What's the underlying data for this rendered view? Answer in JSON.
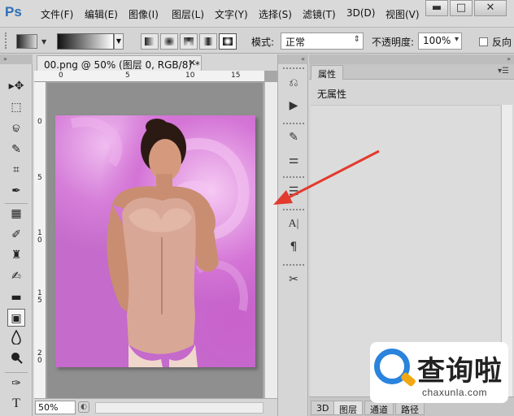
{
  "app": {
    "logo": "Ps",
    "menu": [
      "文件(F)",
      "编辑(E)",
      "图像(I)",
      "图层(L)",
      "文字(Y)",
      "选择(S)",
      "滤镜(T)",
      "3D(D)",
      "视图(V)"
    ],
    "window_buttons": {
      "minimize": "▬",
      "maximize": "□",
      "close": "✕"
    }
  },
  "options_bar": {
    "mode_label": "模式:",
    "mode_value": "正常",
    "opacity_label": "不透明度:",
    "opacity_value": "100%",
    "reverse_label": "反向"
  },
  "toolbox": {
    "tools": [
      {
        "icon": "move-icon",
        "glyph": "▸✥"
      },
      {
        "icon": "marquee-icon",
        "glyph": "⬚"
      },
      {
        "icon": "lasso-icon",
        "glyph": "ଢ"
      },
      {
        "icon": "quick-select-icon",
        "glyph": "✎"
      },
      {
        "icon": "crop-icon",
        "glyph": "⌗"
      },
      {
        "icon": "eyedropper-icon",
        "glyph": "✒"
      },
      {
        "icon": "healing-brush-icon",
        "glyph": "▦"
      },
      {
        "icon": "brush-icon",
        "glyph": "✐"
      },
      {
        "icon": "clone-stamp-icon",
        "glyph": "♜"
      },
      {
        "icon": "history-brush-icon",
        "glyph": "✍"
      },
      {
        "icon": "eraser-icon",
        "glyph": "▬"
      },
      {
        "icon": "gradient-icon",
        "glyph": "▣"
      },
      {
        "icon": "blur-icon",
        "glyph": "💧"
      },
      {
        "icon": "dodge-icon",
        "glyph": "●"
      },
      {
        "icon": "pen-icon",
        "glyph": "✑"
      },
      {
        "icon": "type-icon",
        "glyph": "T"
      }
    ]
  },
  "document": {
    "tab_title": "00.png @ 50% (图层 0, RGB/8) *",
    "tab_close": "✕",
    "ruler_h": [
      "0",
      "5",
      "10",
      "15"
    ],
    "ruler_v": [
      "0",
      "5",
      "1\n0",
      "1\n5",
      "2\n0"
    ],
    "zoom": "50%"
  },
  "properties_panel": {
    "tab": "属性",
    "content": "无属性",
    "bottom_tabs": [
      "3D",
      "图层",
      "通道",
      "路径"
    ]
  },
  "watermark": {
    "chinese": "查询啦",
    "url": "chaxunla.com"
  },
  "colors": {
    "arrow": "#e23a2e",
    "ps_blue": "#2d6fb7",
    "watermark_blue": "#2a83dc",
    "watermark_orange": "#f2a814"
  }
}
